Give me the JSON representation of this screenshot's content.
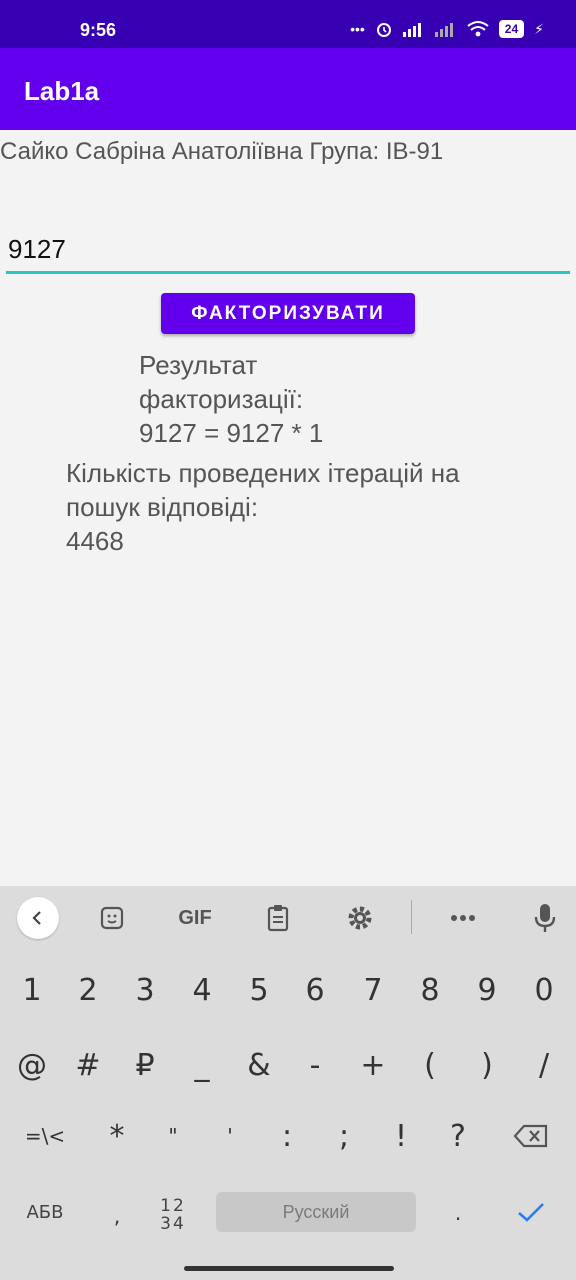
{
  "status_bar": {
    "time": "9:56",
    "battery": "24"
  },
  "app_bar": {
    "title": "Lab1a"
  },
  "content": {
    "author_line": "Сайко Сабріна Анатоліївна Група: ІВ-91",
    "input_value": "9127",
    "factorize_button": "ФАКТОРИЗУВАТИ",
    "result_label": "Результат факторизації:",
    "result_value": "9127 = 9127 * 1",
    "iterations_label": "Кількість проведених ітерацій на пошук відповіді:",
    "iterations_value": "4468"
  },
  "keyboard": {
    "toolbar": {
      "gif_label": "GIF"
    },
    "row_digits": [
      "1",
      "2",
      "3",
      "4",
      "5",
      "6",
      "7",
      "8",
      "9",
      "0"
    ],
    "row_symbols": [
      "@",
      "#",
      "₽",
      "_",
      "&",
      "-",
      "+",
      "(",
      ")",
      "/"
    ],
    "row_more": [
      "=\\<",
      "*",
      "\"",
      "'",
      ":",
      ";",
      "!",
      "?"
    ],
    "bottom": {
      "lang_key": "АБВ",
      "comma": ",",
      "toggle_top": "12",
      "toggle_bottom": "34",
      "space_label": "Русский",
      "period": "."
    }
  },
  "colors": {
    "status_bar": "#3700b3",
    "app_bar": "#6200ee",
    "accent": "#26c6c6",
    "background": "#f3f3f3",
    "keyboard": "#dcdcdc"
  }
}
